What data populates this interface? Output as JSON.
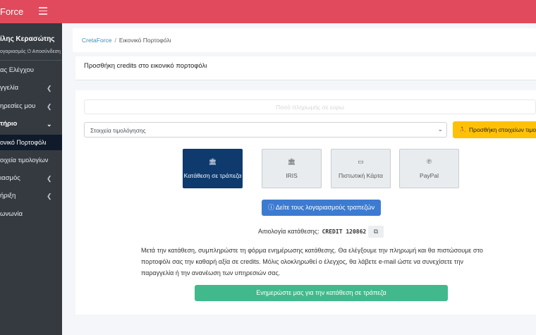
{
  "app": {
    "brand": "Force"
  },
  "sidebar": {
    "user_name": "ίλης Κερασώτης",
    "user_links": "ογαριασμός ⏻ Αποσύνδεση",
    "items": [
      {
        "label": "ας Ελέγχου"
      },
      {
        "label": "γγελία"
      },
      {
        "label": "ηρεσίες μου"
      },
      {
        "label": "τήριο"
      },
      {
        "label": "ονικό Πορτοφόλι"
      },
      {
        "label": "οιχεία τιμολογίων"
      },
      {
        "label": "ιασμός"
      },
      {
        "label": "ήριξη"
      },
      {
        "label": "ωνωνία"
      }
    ]
  },
  "breadcrumb": {
    "home": "CretaForce",
    "separator": "/",
    "current": "Εικονικό Πορτοφόλι"
  },
  "card": {
    "title": "Προσθήκη credits στο εικονικό πορτοφόλι"
  },
  "form": {
    "amount_placeholder": "Ποσό πληρωμής σε ευρω",
    "billing_select_value": "Στοιχεία τιμολόγησης",
    "add_billing_label": "Προσθήκη στοιχείων τιμολό"
  },
  "payment_methods": [
    {
      "label": "Κατάθεση σε τράπεζα",
      "icon": "bank-icon",
      "active": true
    },
    {
      "label": "IRIS",
      "icon": "bank-icon",
      "active": false
    },
    {
      "label": "Πιστωτική Κάρτα",
      "icon": "credit-card-icon",
      "active": false
    },
    {
      "label": "PayPal",
      "icon": "paypal-icon",
      "active": false
    }
  ],
  "bank": {
    "accounts_button": "Δείτε τους λογαριασμούς τραπεζών",
    "reference_label": "Αιτιολογία κατάθεσης:",
    "reference_code": "CREDIT 120862",
    "info_text": "Μετά την κατάθεση, συμπληρώστε τη φόρμα ενημέρωσης κατάθεσης. Θα ελέγξουμε την πληρωμή και θα πιστώσουμε στο πορτοφόλι σας την καθαρή αξία σε credits. Μόλις ολοκληρωθεί ο έλεγχος, θα λάβετε e-mail ώστε να συνεχίσετε την παραγγελία ή την ανανέωση των υπηρεσιών σας.",
    "notify_button": "Ενημερώστε μας για την κατάθεση σε τράπεζα"
  },
  "colors": {
    "topbar": "#e14a5c",
    "sidebar": "#343a40",
    "active_method": "#0e3a6e",
    "warning": "#ffc107",
    "info": "#3c7bd0",
    "success": "#42b98c"
  }
}
